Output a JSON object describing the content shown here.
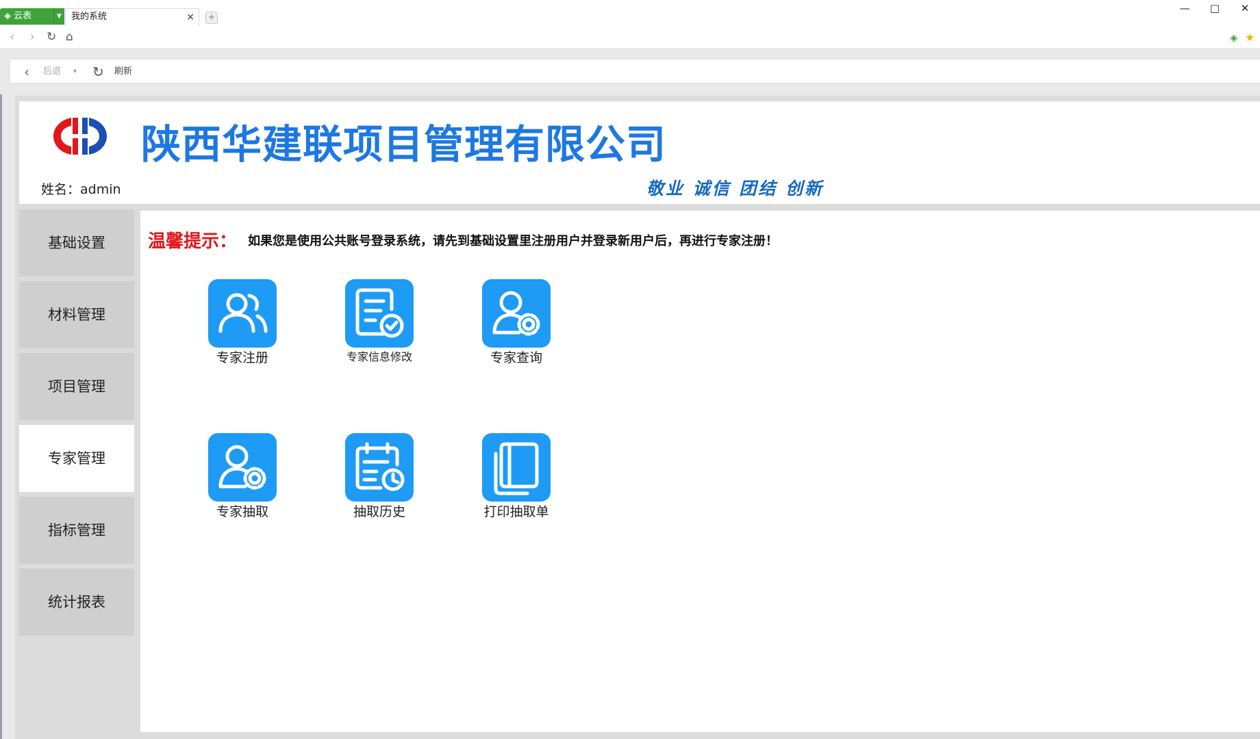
{
  "browser": {
    "app_badge": "云表",
    "tab_title": "我的系统",
    "tab_close": "×",
    "new_tab": "+",
    "window": {
      "minimize": "—",
      "maximize": "□",
      "close": "✕"
    },
    "nav_icons": [
      "back-icon",
      "forward-icon",
      "reload-icon",
      "home-icon"
    ],
    "toolbar": {
      "back_label": "后退",
      "refresh_label": "刷新"
    }
  },
  "header": {
    "company_name": "陕西华建联项目管理有限公司",
    "user_label": "姓名：admin",
    "motto": "敬业 诚信 团结 创新",
    "brand_color": "#1d78e2"
  },
  "sidebar": {
    "items": [
      {
        "label": "基础设置",
        "active": false
      },
      {
        "label": "材料管理",
        "active": false
      },
      {
        "label": "项目管理",
        "active": false
      },
      {
        "label": "专家管理",
        "active": true
      },
      {
        "label": "指标管理",
        "active": false
      },
      {
        "label": "统计报表",
        "active": false
      }
    ]
  },
  "main": {
    "tip_label": "温馨提示：",
    "tip_text": "如果您是使用公共账号登录系统，请先到基础设置里注册用户并登录新用户后，再进行专家注册！",
    "tip_color": "#e4151b",
    "tile_color": "#1e9bf5",
    "tiles": [
      {
        "label": "专家注册",
        "icon": "users-icon"
      },
      {
        "label": "专家信息修改",
        "icon": "document-check-icon"
      },
      {
        "label": "专家查询",
        "icon": "user-gear-icon"
      },
      {
        "label": "专家抽取",
        "icon": "user-gear-icon"
      },
      {
        "label": "抽取历史",
        "icon": "calendar-clock-icon"
      },
      {
        "label": "打印抽取单",
        "icon": "book-icon"
      }
    ]
  }
}
